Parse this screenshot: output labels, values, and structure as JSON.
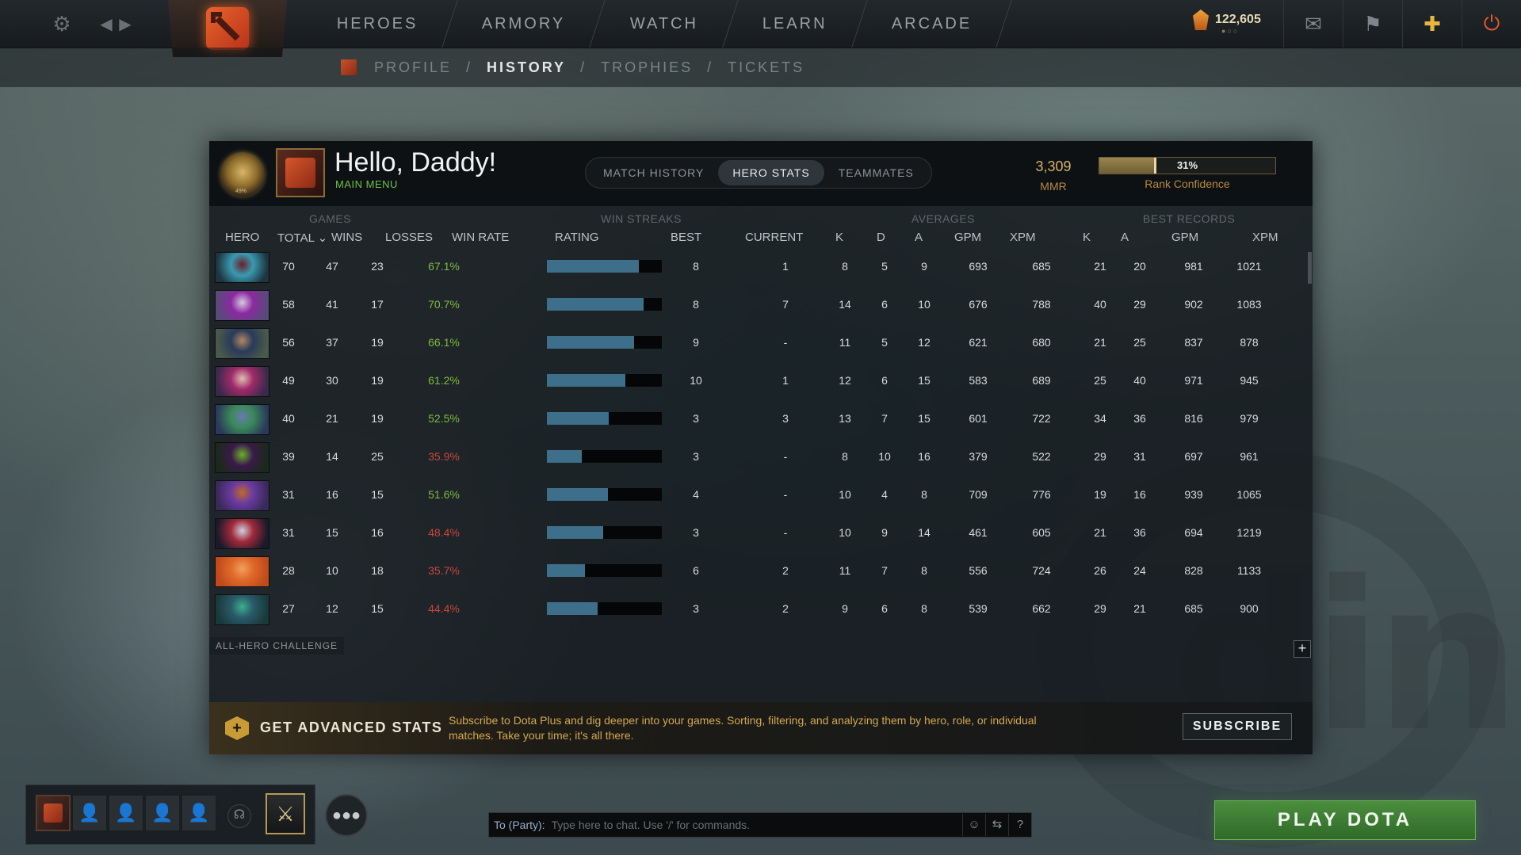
{
  "nav": {
    "links": [
      "HEROES",
      "ARMORY",
      "WATCH",
      "LEARN",
      "ARCADE"
    ],
    "currency": "122,605"
  },
  "subnav": {
    "crumbs": [
      "PROFILE",
      "HISTORY",
      "TROPHIES",
      "TICKETS"
    ],
    "active": "HISTORY"
  },
  "profile": {
    "greeting": "Hello, Daddy!",
    "subtitle": "MAIN MENU",
    "medal_label": "49%",
    "mmr_value": "3,309",
    "mmr_label": "MMR",
    "confidence_pct": "31%",
    "confidence_fraction": 0.31,
    "confidence_label": "Rank Confidence"
  },
  "tabs": [
    {
      "label": "MATCH HISTORY",
      "active": false
    },
    {
      "label": "HERO STATS",
      "active": true
    },
    {
      "label": "TEAMMATES",
      "active": false
    }
  ],
  "table": {
    "groups": {
      "games": "GAMES",
      "win_streaks": "WIN STREAKS",
      "averages": "AVERAGES",
      "best_records": "BEST RECORDS"
    },
    "columns": {
      "hero": "HERO",
      "total": "TOTAL ⌄",
      "wins": "WINS",
      "losses": "LOSSES",
      "win_rate": "WIN RATE",
      "rating": "RATING",
      "best": "BEST",
      "current": "CURRENT",
      "k": "K",
      "d": "D",
      "a": "A",
      "gpm": "GPM",
      "xpm": "XPM",
      "best_k": "K",
      "best_a": "A",
      "best_gpm": "GPM",
      "best_xpm": "XPM"
    },
    "rows": [
      {
        "total": "70",
        "wins": "47",
        "losses": "23",
        "win_rate": "67.1%",
        "rating": 0.8,
        "best": "8",
        "current": "1",
        "k": "8",
        "d": "5",
        "a": "9",
        "gpm": "693",
        "xpm": "685",
        "best_k": "21",
        "best_a": "20",
        "best_gpm": "981",
        "best_xpm": "1021",
        "portrait": [
          "#1d3540",
          "#6a1f2a",
          "#3a9ab0"
        ]
      },
      {
        "total": "58",
        "wins": "41",
        "losses": "17",
        "win_rate": "70.7%",
        "rating": 0.84,
        "best": "8",
        "current": "7",
        "k": "14",
        "d": "6",
        "a": "10",
        "gpm": "676",
        "xpm": "788",
        "best_k": "40",
        "best_a": "29",
        "best_gpm": "902",
        "best_xpm": "1083",
        "portrait": [
          "#5a4a7a",
          "#d8c8e0",
          "#8a2aa0"
        ]
      },
      {
        "total": "56",
        "wins": "37",
        "losses": "19",
        "win_rate": "66.1%",
        "rating": 0.76,
        "best": "9",
        "current": "-",
        "k": "11",
        "d": "5",
        "a": "12",
        "gpm": "621",
        "xpm": "680",
        "best_k": "21",
        "best_a": "25",
        "best_gpm": "837",
        "best_xpm": "878",
        "portrait": [
          "#4a5a4a",
          "#b08860",
          "#2a3a5a"
        ]
      },
      {
        "total": "49",
        "wins": "30",
        "losses": "19",
        "win_rate": "61.2%",
        "rating": 0.68,
        "best": "10",
        "current": "1",
        "k": "12",
        "d": "6",
        "a": "15",
        "gpm": "583",
        "xpm": "689",
        "best_k": "25",
        "best_a": "40",
        "best_gpm": "971",
        "best_xpm": "945",
        "portrait": [
          "#3a2a4a",
          "#e0c0b0",
          "#a02a6a"
        ]
      },
      {
        "total": "40",
        "wins": "21",
        "losses": "19",
        "win_rate": "52.5%",
        "rating": 0.54,
        "best": "3",
        "current": "3",
        "k": "13",
        "d": "7",
        "a": "15",
        "gpm": "601",
        "xpm": "722",
        "best_k": "34",
        "best_a": "36",
        "best_gpm": "816",
        "best_xpm": "979",
        "portrait": [
          "#2a3a5a",
          "#6a7ab0",
          "#3a8a5a"
        ]
      },
      {
        "total": "39",
        "wins": "14",
        "losses": "25",
        "win_rate": "35.9%",
        "rating": 0.3,
        "best": "3",
        "current": "-",
        "k": "8",
        "d": "10",
        "a": "16",
        "gpm": "379",
        "xpm": "522",
        "best_k": "29",
        "best_a": "31",
        "best_gpm": "697",
        "best_xpm": "961",
        "portrait": [
          "#1a2a1a",
          "#6ab02a",
          "#3a1a4a"
        ]
      },
      {
        "total": "31",
        "wins": "16",
        "losses": "15",
        "win_rate": "51.6%",
        "rating": 0.53,
        "best": "4",
        "current": "-",
        "k": "10",
        "d": "4",
        "a": "8",
        "gpm": "709",
        "xpm": "776",
        "best_k": "19",
        "best_a": "16",
        "best_gpm": "939",
        "best_xpm": "1065",
        "portrait": [
          "#3a2a5a",
          "#c06a2a",
          "#6a3aa0"
        ]
      },
      {
        "total": "31",
        "wins": "15",
        "losses": "16",
        "win_rate": "48.4%",
        "rating": 0.49,
        "best": "3",
        "current": "-",
        "k": "10",
        "d": "9",
        "a": "14",
        "gpm": "461",
        "xpm": "605",
        "best_k": "21",
        "best_a": "36",
        "best_gpm": "694",
        "best_xpm": "1219",
        "portrait": [
          "#1a1a2a",
          "#d0d0e0",
          "#a02a3a"
        ]
      },
      {
        "total": "28",
        "wins": "10",
        "losses": "18",
        "win_rate": "35.7%",
        "rating": 0.33,
        "best": "6",
        "current": "2",
        "k": "11",
        "d": "7",
        "a": "8",
        "gpm": "556",
        "xpm": "724",
        "best_k": "26",
        "best_a": "24",
        "best_gpm": "828",
        "best_xpm": "1133",
        "portrait": [
          "#c04a1a",
          "#f0a060",
          "#e06a2a"
        ]
      },
      {
        "total": "27",
        "wins": "12",
        "losses": "15",
        "win_rate": "44.4%",
        "rating": 0.44,
        "best": "3",
        "current": "2",
        "k": "9",
        "d": "6",
        "a": "8",
        "gpm": "539",
        "xpm": "662",
        "best_k": "29",
        "best_a": "21",
        "best_gpm": "685",
        "best_xpm": "900",
        "portrait": [
          "#1a3a3a",
          "#3ab08a",
          "#2a5a6a"
        ]
      }
    ],
    "footer_label": "ALL-HERO CHALLENGE",
    "add_icon": "plus-icon"
  },
  "advanced": {
    "title": "GET ADVANCED STATS",
    "text": "Subscribe to Dota Plus and dig deeper into your games. Sorting, filtering, and analyzing them by hero, role, or individual matches. Take your time; it's all there.",
    "button": "SUBSCRIBE"
  },
  "chat": {
    "label": "To (Party):",
    "placeholder": "Type here to chat. Use '/' for commands."
  },
  "play_button": "PLAY DOTA",
  "colors": {
    "win_rate_positive": "#7dbb3f",
    "win_rate_negative": "#c9463a",
    "rating_fill": "#3e6f8a",
    "accent_gold": "#d6b16a",
    "play_green": "#3f7d34"
  }
}
